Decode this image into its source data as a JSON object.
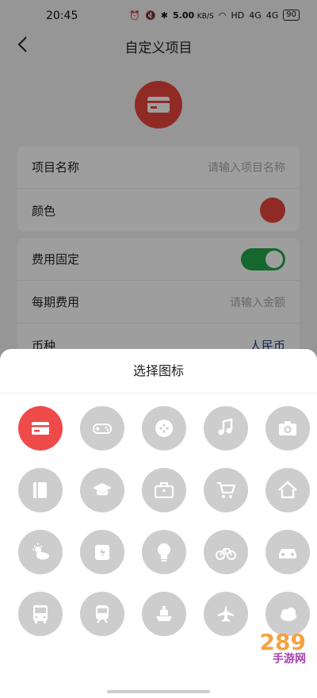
{
  "status_bar": {
    "time": "20:45",
    "net_speed": "5.00",
    "net_unit": "KB/S",
    "hd": "HD",
    "signal1": "4G",
    "signal2": "4G",
    "battery": "90"
  },
  "nav": {
    "title": "自定义项目"
  },
  "form": {
    "name_label": "项目名称",
    "name_placeholder": "请输入项目名称",
    "color_label": "颜色",
    "fixed_label": "费用固定",
    "fee_label": "每期费用",
    "fee_placeholder": "请输入金额",
    "currency_label": "币种",
    "currency_value": "人民币"
  },
  "sheet": {
    "title": "选择图标",
    "icons": [
      "card-icon",
      "gamepad-icon",
      "chat-bubble-icon",
      "music-note-icon",
      "camera-icon",
      "book-icon",
      "graduation-cap-icon",
      "briefcase-icon",
      "shopping-cart-icon",
      "home-icon",
      "weather-icon",
      "power-bank-icon",
      "lightbulb-icon",
      "bicycle-icon",
      "car-icon",
      "bus-icon",
      "train-icon",
      "ship-icon",
      "airplane-icon",
      "cloud-icon"
    ],
    "selected_index": 0
  },
  "watermark": {
    "main": "289",
    "sub": "手游网"
  },
  "colors": {
    "accent_red": "#e8453c",
    "toggle_green": "#22a64a",
    "icon_gray": "#cdcdcd"
  }
}
